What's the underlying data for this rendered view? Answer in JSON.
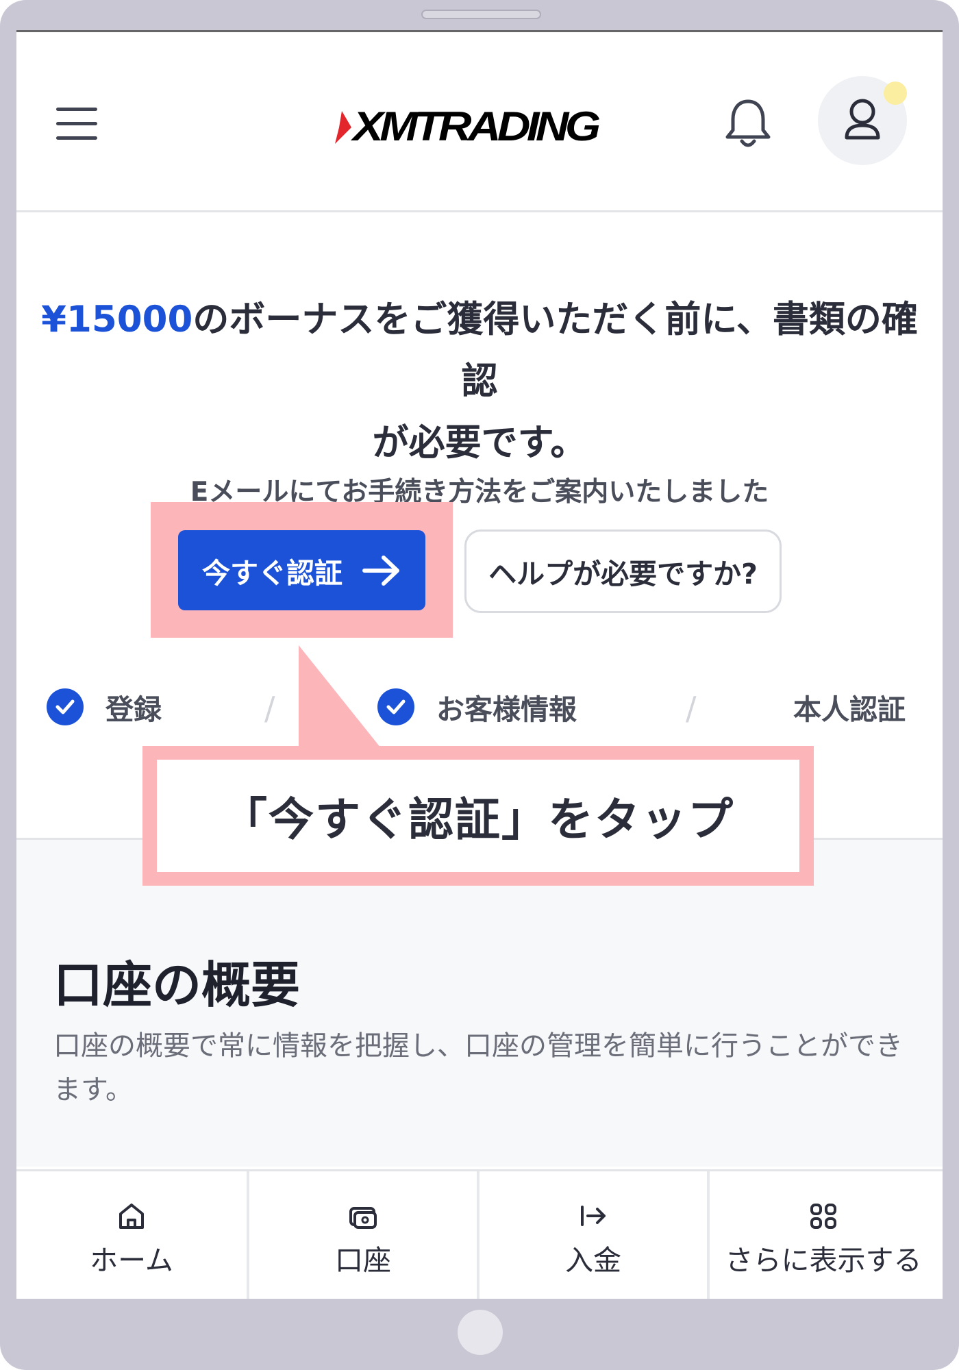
{
  "header": {
    "logo_text": "XMTRADING",
    "menu_icon": "hamburger-menu-icon",
    "bell_icon": "bell-icon",
    "user_icon": "user-icon",
    "accent_color": "#1b52d8",
    "logo_accent_color": "#e3262b"
  },
  "verification": {
    "bonus_amount": "¥15000",
    "headline_line1": "のボーナスをご獲得いただく前に、書類の確認",
    "headline_line2": "が必要です。",
    "subtext": "Eメールにてお手続き方法をご案内いたしました",
    "verify_button": "今すぐ認証",
    "help_button": "ヘルプが必要ですか?"
  },
  "steps": [
    {
      "label": "登録",
      "done": true
    },
    {
      "label": "お客様情報",
      "done": true
    },
    {
      "label": "本人認証",
      "done": false
    }
  ],
  "callout": {
    "text": "「今すぐ認証」をタップ",
    "color": "#fcb6ba"
  },
  "overview": {
    "title": "口座の概要",
    "description": "口座の概要で常に情報を把握し、口座の管理を簡単に行うことができます。"
  },
  "bottom_nav": [
    {
      "label": "ホーム",
      "icon": "home-icon"
    },
    {
      "label": "口座",
      "icon": "wallet-icon"
    },
    {
      "label": "入金",
      "icon": "deposit-arrow-icon"
    },
    {
      "label": "さらに表示する",
      "icon": "grid-icon"
    }
  ]
}
